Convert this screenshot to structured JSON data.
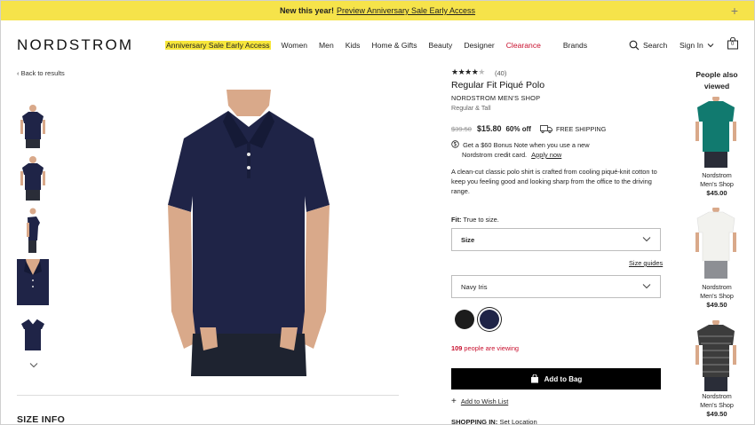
{
  "banner": {
    "lead": "New this year!",
    "link": "Preview Anniversary Sale Early Access"
  },
  "header": {
    "logo": "NORDSTROM",
    "nav": [
      "Anniversary Sale Early Access",
      "Women",
      "Men",
      "Kids",
      "Home & Gifts",
      "Beauty",
      "Designer",
      "Clearance",
      "Brands"
    ],
    "search_label": "Search",
    "signin_label": "Sign In",
    "bag_count": "0"
  },
  "back_label": "Back to results",
  "product": {
    "rating": 4.5,
    "review_count": "(40)",
    "title": "Regular Fit Piqué Polo",
    "brand": "NORDSTROM MEN'S SHOP",
    "fit_type": "Regular & Tall",
    "original_price": "$39.50",
    "sale_price": "$15.80",
    "discount": "60% off",
    "shipping": "FREE SHIPPING",
    "bonus_line1": "Get a $60 Bonus Note when you use a new",
    "bonus_line2": "Nordstrom credit card.",
    "bonus_link": "Apply now",
    "description": "A clean-cut classic polo shirt is crafted from cooling piqué-knit cotton to keep you feeling good and looking sharp from the office to the driving range.",
    "fit_label": "Fit:",
    "fit_value": "True to size.",
    "size_placeholder": "Size",
    "size_guides": "Size guides",
    "color_selected": "Navy Iris",
    "swatches": [
      {
        "name": "Black",
        "color": "#1c1c1c"
      },
      {
        "name": "Navy Iris",
        "color": "#1f2447"
      }
    ],
    "viewing_count": "109",
    "viewing_text": "people are viewing",
    "add_to_bag": "Add to Bag",
    "wish_list": "Add to Wish List",
    "shopping_in_label": "SHOPPING IN:",
    "set_location": "Set Location"
  },
  "size_info_heading": "SIZE INFO",
  "rail": {
    "title_line1": "People also",
    "title_line2": "viewed",
    "items": [
      {
        "brand1": "Nordstrom",
        "brand2": "Men's Shop",
        "price": "$45.00",
        "color": "#117a6f"
      },
      {
        "brand1": "Nordstrom",
        "brand2": "Men's Shop",
        "price": "$49.50",
        "color": "#f2f2ee"
      },
      {
        "brand1": "Nordstrom",
        "brand2": "Men's Shop",
        "price": "$49.50",
        "color": "#3c3c3c"
      }
    ]
  },
  "colors": {
    "banner": "#f6e34a",
    "highlight": "#f7e63b",
    "clearance": "#c8102e",
    "polo_navy": "#1f2447"
  }
}
